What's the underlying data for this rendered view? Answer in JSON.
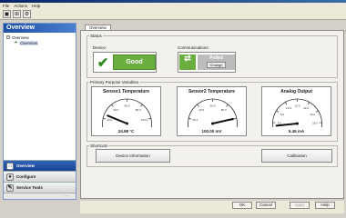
{
  "menu": [
    "File",
    "Actions",
    "Help"
  ],
  "toolbar": {
    "icons": [
      "device-icon",
      "network-icon",
      "settings-icon"
    ]
  },
  "left": {
    "header": "Overview",
    "tree": {
      "root": "Overview",
      "child": "Overview"
    },
    "nav": [
      {
        "label": "Overview",
        "icon": "overview-icon",
        "active": true
      },
      {
        "label": "Configure",
        "icon": "configure-icon",
        "active": false
      },
      {
        "label": "Service Tools",
        "icon": "service-tools-icon",
        "active": false
      }
    ]
  },
  "tab": "Overview",
  "status": {
    "group_label": "Status",
    "device_label": "Device:",
    "device_value": "Good",
    "comm_label": "Communications:",
    "comm_value": "Polled",
    "change_button": "Change"
  },
  "variables": {
    "group_label": "Primary Purpose Variables",
    "gauges": [
      {
        "title": "Sensor1 Temperature",
        "reading": "24.98 °C",
        "ticks": [
          "0.0",
          "20.0",
          "40.0",
          "60.0",
          "80.0",
          "100.0",
          "120.0"
        ],
        "fraction": 0.21
      },
      {
        "title": "Sensor2 Temperature",
        "reading": "100.00 mV",
        "ticks": [
          "0.0",
          "20.0",
          "40.0",
          "60.0",
          "80.0",
          "100.0",
          "120.0"
        ],
        "fraction": 0.83
      },
      {
        "title": "Analog Output",
        "reading": "5.45 mA",
        "ticks": [
          "4.0",
          "6.0",
          "8.0",
          "10.0",
          "12.0",
          "14.0",
          "16.0",
          "18.0",
          "20.0"
        ],
        "fraction": 0.09
      }
    ]
  },
  "shortcuts": {
    "group_label": "Shortcuts",
    "device_info": "Device Information",
    "calibration": "Calibration"
  },
  "footer": {
    "ok": "OK",
    "cancel": "Cancel",
    "apply": "Apply",
    "help": "Help"
  },
  "colors": {
    "good": "#6aae3f",
    "polled": "#bcbcbc",
    "nav_active": "#1a4290"
  }
}
